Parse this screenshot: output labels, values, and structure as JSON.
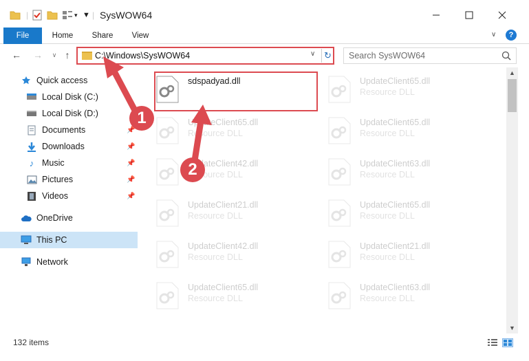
{
  "window": {
    "title": "SysWOW64",
    "controls": [
      "minimize",
      "maximize",
      "close"
    ]
  },
  "ribbon": {
    "tabs": [
      "File",
      "Home",
      "Share",
      "View"
    ],
    "help_icon": "?"
  },
  "navigation": {
    "address_path": "C:\\Windows\\SysWOW64",
    "search_placeholder": "Search SysWOW64"
  },
  "sidebar": {
    "items": [
      {
        "label": "Quick access",
        "icon": "star-icon"
      },
      {
        "label": "Local Disk (C:)",
        "icon": "drive-icon"
      },
      {
        "label": "Local Disk (D:)",
        "icon": "drive-icon"
      },
      {
        "label": "Documents",
        "icon": "documents-icon",
        "pinned": true
      },
      {
        "label": "Downloads",
        "icon": "download-icon",
        "pinned": true
      },
      {
        "label": "Music",
        "icon": "music-icon",
        "pinned": true
      },
      {
        "label": "Pictures",
        "icon": "pictures-icon",
        "pinned": true
      },
      {
        "label": "Videos",
        "icon": "videos-icon",
        "pinned": true
      },
      {
        "label": "OneDrive",
        "icon": "cloud-icon"
      },
      {
        "label": "This PC",
        "icon": "computer-icon",
        "selected": true
      },
      {
        "label": "Network",
        "icon": "network-icon"
      }
    ]
  },
  "files": [
    {
      "name": "sdspadyad.dll",
      "type": "",
      "highlighted": true
    },
    {
      "name": "UpdateClient65.dll",
      "type": "Resource DLL"
    },
    {
      "name": "UpdateClient65.dll",
      "type": "Resource DLL"
    },
    {
      "name": "UpdateClient65.dll",
      "type": "Resource DLL"
    },
    {
      "name": "UpdateClient42.dll",
      "type": "Resource DLL"
    },
    {
      "name": "UpdateClient63.dll",
      "type": "Resource DLL"
    },
    {
      "name": "UpdateClient21.dll",
      "type": "Resource DLL"
    },
    {
      "name": "UpdateClient65.dll",
      "type": "Resource DLL"
    },
    {
      "name": "UpdateClient42.dll",
      "type": "Resource DLL"
    },
    {
      "name": "UpdateClient21.dll",
      "type": "Resource DLL"
    },
    {
      "name": "UpdateClient65.dll",
      "type": "Resource DLL"
    },
    {
      "name": "UpdateClient63.dll",
      "type": "Resource DLL"
    }
  ],
  "status": {
    "item_count": "132 items"
  },
  "annotations": {
    "step1": "1",
    "step2": "2",
    "accent_color": "#dc4a50"
  }
}
